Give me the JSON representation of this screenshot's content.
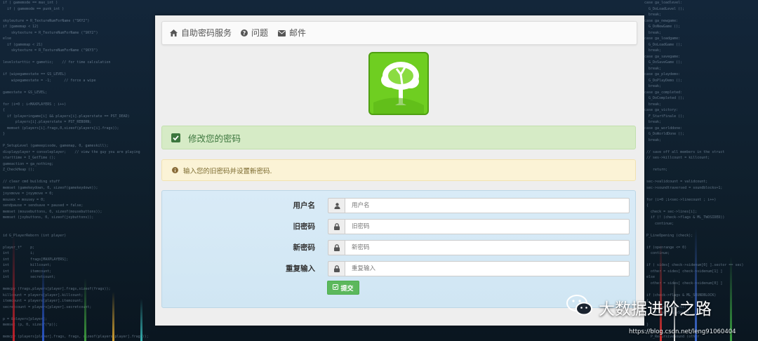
{
  "navbar": {
    "items": [
      {
        "label": "自助密码服务",
        "icon": "home-icon"
      },
      {
        "label": "问题",
        "icon": "question-circle-icon"
      },
      {
        "label": "邮件",
        "icon": "envelope-icon"
      }
    ]
  },
  "alerts": {
    "success": {
      "text": "修改您的密码",
      "icon": "check-square-icon"
    },
    "warning": {
      "text": "输入您的旧密码并设置新密码.",
      "icon": "info-circle-icon"
    }
  },
  "form": {
    "fields": [
      {
        "label": "用户名",
        "placeholder": "用户名",
        "icon": "user-icon",
        "value": ""
      },
      {
        "label": "旧密码",
        "placeholder": "旧密码",
        "icon": "lock-icon",
        "value": ""
      },
      {
        "label": "新密码",
        "placeholder": "新密码",
        "icon": "lock-icon",
        "value": ""
      },
      {
        "label": "重复输入",
        "placeholder": "重复输入",
        "icon": "lock-icon",
        "value": ""
      }
    ],
    "submit_label": "提交"
  },
  "watermark": {
    "title": "大数据进阶之路",
    "url": "https://blog.csdn.net/leng91060404"
  },
  "colors": {
    "success_bg": "#d6ebc6",
    "warning_bg": "#fbf3d6",
    "form_bg": "#d9ebf7",
    "submit": "#5cb85c",
    "logo_green": "#6fce21"
  }
}
